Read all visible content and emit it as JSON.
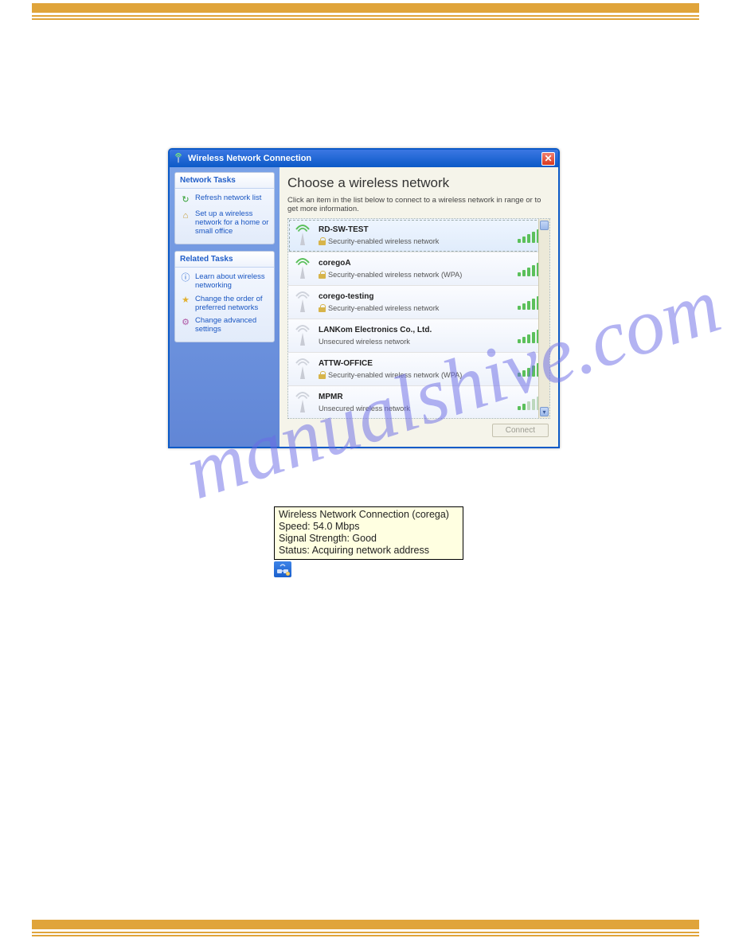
{
  "watermark": "manualshive.com",
  "window": {
    "title": "Wireless Network Connection"
  },
  "sidebar": {
    "panels": [
      {
        "title": "Network Tasks",
        "items": [
          "Refresh network list",
          "Set up a wireless network for a home or small office"
        ]
      },
      {
        "title": "Related Tasks",
        "items": [
          "Learn about wireless networking",
          "Change the order of preferred networks",
          "Change advanced settings"
        ]
      }
    ]
  },
  "main": {
    "heading": "Choose a wireless network",
    "subtext": "Click an item in the list below to connect to a wireless network in range or to get more information.",
    "connect_label": "Connect",
    "networks": [
      {
        "ssid": "RD-SW-TEST",
        "security": "Security-enabled wireless network",
        "signal": 5,
        "selected": true
      },
      {
        "ssid": "coregoA",
        "security": "Security-enabled wireless network (WPA)",
        "signal": 5
      },
      {
        "ssid": "corego-testing",
        "security": "Security-enabled wireless network",
        "signal": 5
      },
      {
        "ssid": "LANKom Electronics Co., Ltd.",
        "security": "Unsecured wireless network",
        "signal": 5
      },
      {
        "ssid": "ATTW-OFFICE",
        "security": "Security-enabled wireless network (WPA)",
        "signal": 5
      },
      {
        "ssid": "MPMR",
        "security": "Unsecured wireless network",
        "signal": 2
      }
    ]
  },
  "tooltip": {
    "line1": "Wireless Network Connection (corega)",
    "line2": "Speed: 54.0 Mbps",
    "line3": "Signal Strength: Good",
    "line4": "Status: Acquiring network address"
  }
}
